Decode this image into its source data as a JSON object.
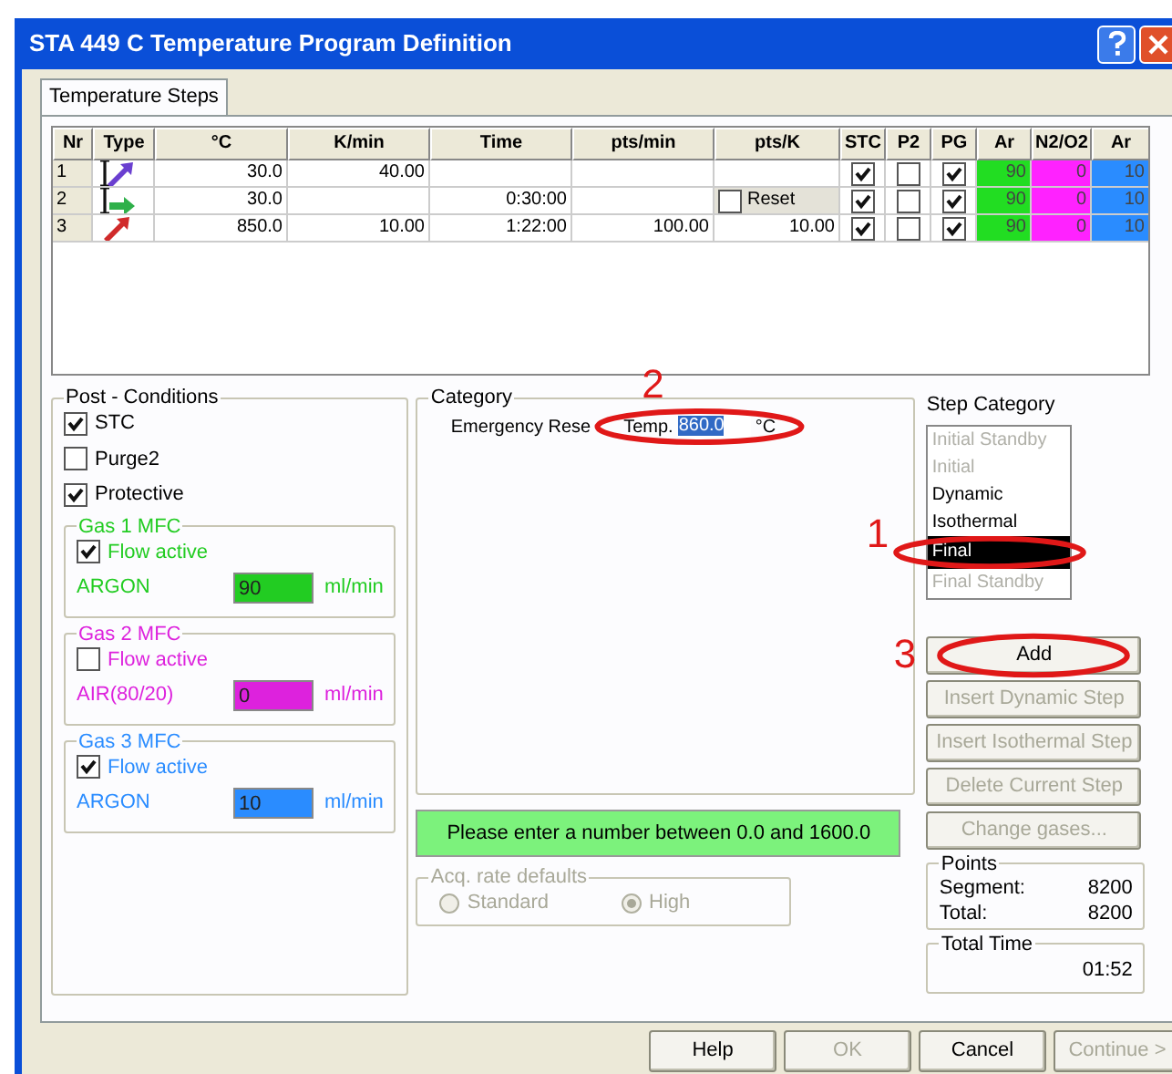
{
  "window": {
    "title": "STA 449 C  Temperature Program Definition"
  },
  "tabs": [
    {
      "label": "Temperature Steps",
      "selected": true
    }
  ],
  "table": {
    "columns": [
      "Nr",
      "Type",
      "°C",
      "K/min",
      "Time",
      "pts/min",
      "pts/K",
      "STC",
      "P2",
      "PG",
      "Ar",
      "N2/O2",
      "Ar"
    ],
    "rows": [
      {
        "nr": "1",
        "type": {
          "kind": "ramp"
        },
        "celsius": "30.0",
        "kmin": "40.00",
        "pts_k": {
          "kind": "empty"
        },
        "stc": true,
        "p2": false,
        "pg": true,
        "gases": [
          {
            "value": "90",
            "color": "#22dd22"
          },
          {
            "value": "0",
            "color": "#ff22ff"
          },
          {
            "value": "10",
            "color": "#2a8cff"
          }
        ]
      },
      {
        "nr": "2",
        "type": {
          "kind": "hold"
        },
        "celsius": "30.0",
        "time": "0:30:00",
        "pts_k": {
          "kind": "reset",
          "text": "Reset",
          "checked": false
        },
        "stc": true,
        "p2": false,
        "pg": true,
        "gases": [
          {
            "value": "90",
            "color": "#22dd22"
          },
          {
            "value": "0",
            "color": "#ff22ff"
          },
          {
            "value": "10",
            "color": "#2a8cff"
          }
        ]
      },
      {
        "nr": "3",
        "type": {
          "kind": "heat"
        },
        "celsius": "850.0",
        "kmin": "10.00",
        "time": "1:22:00",
        "pts_min": "100.00",
        "pts_k": {
          "kind": "text",
          "text": "10.00"
        },
        "stc": true,
        "p2": false,
        "pg": true,
        "gases": [
          {
            "value": "90",
            "color": "#22dd22"
          },
          {
            "value": "0",
            "color": "#ff22ff"
          },
          {
            "value": "10",
            "color": "#2a8cff"
          }
        ]
      }
    ]
  },
  "post_conditions": {
    "title": "Post - Conditions",
    "checks": [
      {
        "label": "STC",
        "checked": true
      },
      {
        "label": "Purge2",
        "checked": false
      },
      {
        "label": "Protective",
        "checked": true
      }
    ],
    "gases": [
      {
        "title": "Gas 1 MFC",
        "flow_label": "Flow active",
        "flow_active": true,
        "gas": "ARGON",
        "value": "90",
        "unit": "ml/min",
        "color": "#22cc22"
      },
      {
        "title": "Gas 2 MFC",
        "flow_label": "Flow active",
        "flow_active": false,
        "gas": "AIR(80/20)",
        "value": "0",
        "unit": "ml/min",
        "color": "#dd22dd"
      },
      {
        "title": "Gas 3 MFC",
        "flow_label": "Flow active",
        "flow_active": true,
        "gas": "ARGON",
        "value": "10",
        "unit": "ml/min",
        "color": "#2a8cff"
      }
    ]
  },
  "category": {
    "title": "Category",
    "label": "Emergency Rese",
    "temp_label": "Temp.",
    "temp_value": "860.0",
    "unit": "°C"
  },
  "message": "Please enter a number between 0.0 and 1600.0",
  "acq_rate": {
    "title": "Acq. rate defaults",
    "disabled": true,
    "options": [
      {
        "label": "Standard",
        "selected": false
      },
      {
        "label": "High",
        "selected": true
      }
    ]
  },
  "step_category": {
    "title": "Step Category",
    "items": [
      {
        "label": "Initial Standby",
        "disabled": true,
        "selected": false
      },
      {
        "label": "Initial",
        "disabled": true,
        "selected": false
      },
      {
        "label": "Dynamic",
        "disabled": false,
        "selected": false
      },
      {
        "label": "Isothermal",
        "disabled": false,
        "selected": false
      },
      {
        "label": "Final",
        "disabled": false,
        "selected": true
      },
      {
        "label": "Final Standby",
        "disabled": true,
        "selected": false
      }
    ]
  },
  "side_buttons": [
    {
      "label": "Add",
      "disabled": false
    },
    {
      "label": "Insert Dynamic Step",
      "disabled": true
    },
    {
      "label": "Insert Isothermal Step",
      "disabled": true
    },
    {
      "label": "Delete Current Step",
      "disabled": true
    },
    {
      "label": "Change gases...",
      "disabled": true
    }
  ],
  "points": {
    "title": "Points",
    "rows": [
      {
        "label": "Segment:",
        "value": "8200"
      },
      {
        "label": "Total:",
        "value": "8200"
      }
    ]
  },
  "total_time": {
    "title": "Total Time",
    "value": "01:52"
  },
  "footer_buttons": [
    {
      "label": "Help",
      "disabled": false
    },
    {
      "label": "OK",
      "disabled": true
    },
    {
      "label": "Cancel",
      "disabled": false
    },
    {
      "label": "Continue >",
      "disabled": true
    }
  ],
  "annotations": [
    {
      "number": "2"
    },
    {
      "number": "1"
    },
    {
      "number": "3"
    }
  ]
}
